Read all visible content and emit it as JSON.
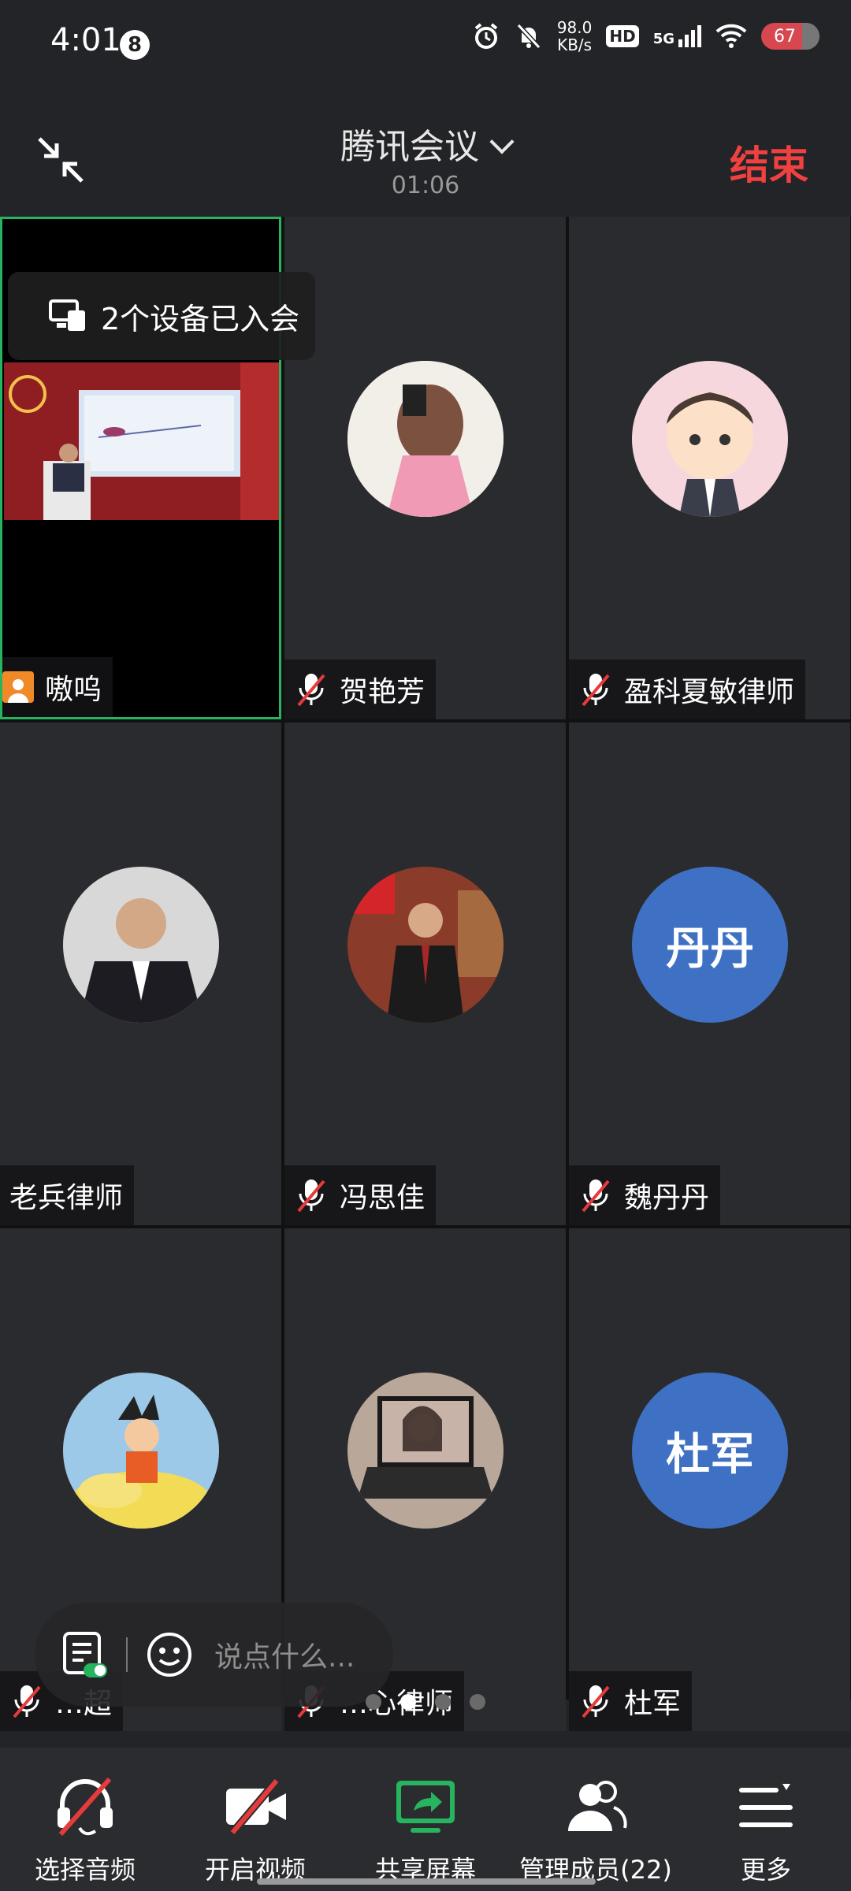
{
  "status_bar": {
    "time": "4:01",
    "notification_count": "8",
    "net_speed_value": "98.0",
    "net_speed_unit": "KB/s",
    "hd_label": "HD",
    "network_label": "5G",
    "battery_level": "67",
    "icons": [
      "alarm-icon",
      "mute-icon",
      "hd-icon",
      "5g-signal-icon",
      "wifi-icon",
      "battery-icon"
    ]
  },
  "header": {
    "title": "腾讯会议",
    "timer": "01:06",
    "end_label": "结束"
  },
  "devices_toast": "2个设备已入会",
  "participants": [
    {
      "name": "嗷呜",
      "muted": false,
      "avatar_text": ""
    },
    {
      "name": "贺艳芳",
      "muted": true,
      "avatar_text": ""
    },
    {
      "name": "盈科夏敏律师",
      "muted": true,
      "avatar_text": ""
    },
    {
      "name": "老兵律师",
      "muted": false,
      "avatar_text": ""
    },
    {
      "name": "冯思佳",
      "muted": true,
      "avatar_text": ""
    },
    {
      "name": "魏丹丹",
      "muted": true,
      "avatar_text": "丹丹"
    },
    {
      "name": "…超",
      "muted": true,
      "avatar_text": ""
    },
    {
      "name": "…心律师",
      "muted": true,
      "avatar_text": ""
    },
    {
      "name": "杜军",
      "muted": true,
      "avatar_text": "杜军"
    }
  ],
  "chat": {
    "placeholder": "说点什么..."
  },
  "toolbar": {
    "items": [
      {
        "label": "选择音频",
        "icon": "audio-off-icon"
      },
      {
        "label": "开启视频",
        "icon": "video-off-icon"
      },
      {
        "label": "共享屏幕",
        "icon": "share-screen-icon"
      },
      {
        "label": "管理成员(22)",
        "icon": "members-icon"
      },
      {
        "label": "更多",
        "icon": "more-menu-icon"
      }
    ]
  },
  "colors": {
    "accent_green": "#27b45f",
    "end_red": "#f04141",
    "avatar_blue": "#3e71c4"
  }
}
